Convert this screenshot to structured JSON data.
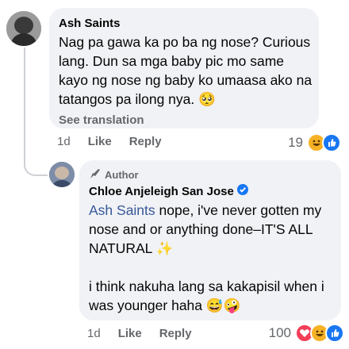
{
  "comment": {
    "author": "Ash Saints",
    "text": "Nag pa gawa ka po ba ng nose? Curious lang. Dun sa mga baby pic mo same kayo ng nose ng baby ko  umaasa ako na tatangos pa ilong nya.",
    "emoji_inline": "🥺",
    "see_translation": "See translation",
    "time": "1d",
    "like": "Like",
    "reply": "Reply",
    "reaction_count": "19"
  },
  "reply": {
    "badge": "Author",
    "author": "Chloe Anjeleigh San Jose",
    "mention": "Ash Saints",
    "text1": " nope, i've never gotten my nose and or anything done–IT'S ALL NATURAL",
    "sparkle": "✨",
    "text2": "i think nakuha lang sa kakapisil when i was younger haha",
    "emojis": "😅🤪",
    "time": "1d",
    "like": "Like",
    "reply": "Reply",
    "reaction_count": "100"
  },
  "colors": {
    "link": "#385898",
    "bubble": "#f0f2f5",
    "verified": "#1877f2",
    "love": "#f33e58",
    "like": "#1877f2",
    "haha": "#f7b125"
  }
}
